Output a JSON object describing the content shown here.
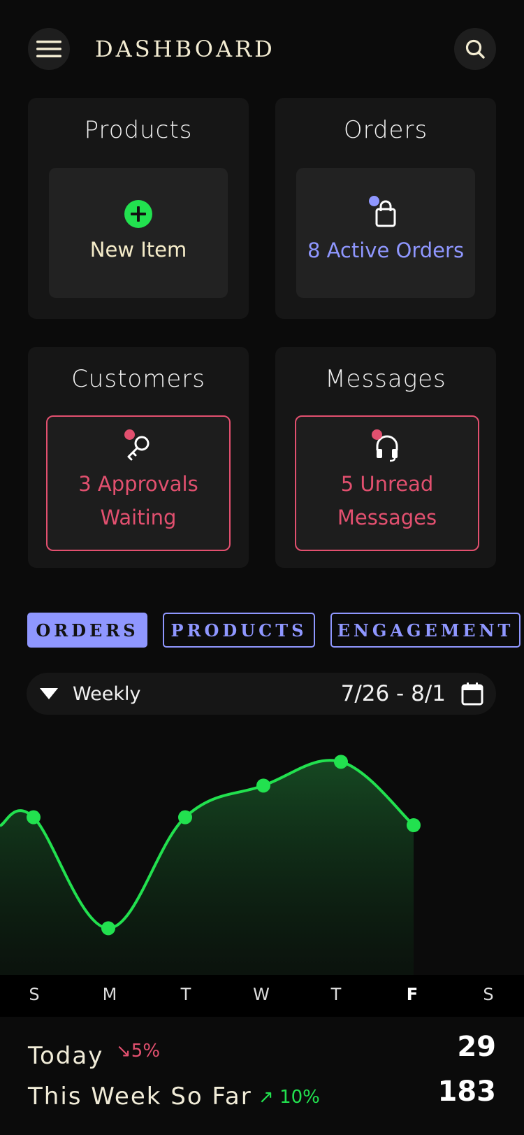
{
  "header": {
    "title": "DASHBOARD"
  },
  "cards": {
    "products": {
      "title": "Products",
      "action_label": "New Item"
    },
    "orders": {
      "title": "Orders",
      "action_label": "8 Active Orders"
    },
    "customers": {
      "title": "Customers",
      "action_label_line1": "3 Approvals",
      "action_label_line2": "Waiting"
    },
    "messages": {
      "title": "Messages",
      "action_label_line1": "5 Unread",
      "action_label_line2": "Messages"
    }
  },
  "tabs": [
    {
      "label": "ORDERS",
      "active": true
    },
    {
      "label": "PRODUCTS",
      "active": false
    },
    {
      "label": "ENGAGEMENT",
      "active": false
    }
  ],
  "range": {
    "period": "Weekly",
    "dates": "7/26 - 8/1"
  },
  "chart_data": {
    "type": "area",
    "categories": [
      "S",
      "M",
      "T",
      "W",
      "T",
      "F"
    ],
    "values": [
      44,
      30,
      44,
      48,
      51,
      43
    ],
    "color": "#22e14f"
  },
  "days": [
    "S",
    "M",
    "T",
    "W",
    "T",
    "F",
    "S"
  ],
  "current_day_index": 5,
  "stats": {
    "today": {
      "label": "Today",
      "change": "5%",
      "direction": "down",
      "value": "29"
    },
    "week": {
      "label": "This Week So Far",
      "change": "10%",
      "direction": "up",
      "value": "183"
    }
  },
  "colors": {
    "accent_blue": "#8f97ff",
    "alert_red": "#e2506f",
    "positive_green": "#22e14f",
    "title_cream": "#f3ecd2"
  }
}
